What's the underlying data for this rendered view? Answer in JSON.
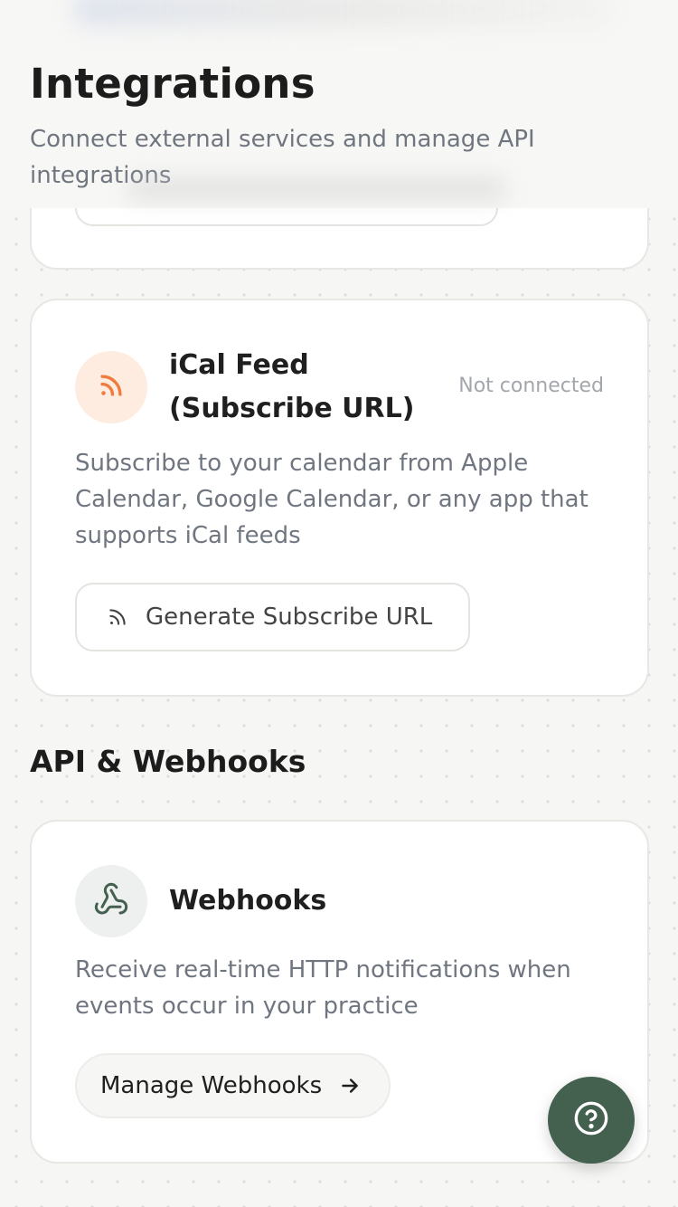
{
  "header": {
    "title": "Integrations",
    "subtitle": "Connect external services and manage API integrations"
  },
  "ical": {
    "title": "iCal Feed (Subscribe URL)",
    "status": "Not connected",
    "description": "Subscribe to your calendar from Apple Calendar, Google Calendar, or any app that supports iCal feeds",
    "button_label": "Generate Subscribe URL",
    "icon": "rss-icon",
    "accent_color": "#f07b3f"
  },
  "api_section": {
    "heading": "API & Webhooks"
  },
  "webhooks": {
    "title": "Webhooks",
    "description": "Receive real-time HTTP notifications when events occur in your practice",
    "button_label": "Manage Webhooks",
    "icon": "webhook-icon",
    "accent_color": "#44604f"
  },
  "help": {
    "icon": "help-circle-icon"
  }
}
